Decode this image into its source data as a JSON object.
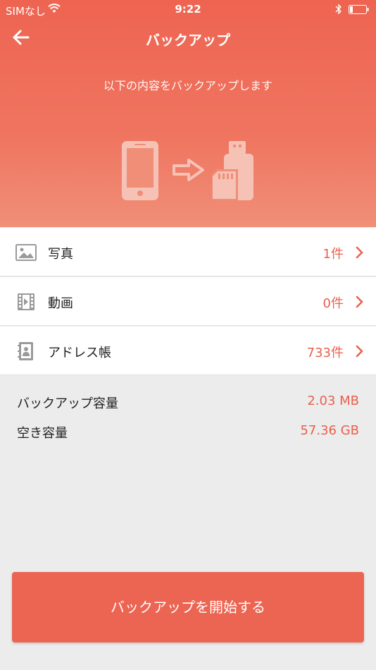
{
  "status_bar": {
    "carrier": "SIMなし",
    "time": "9:22",
    "icons": [
      "wifi-icon",
      "bluetooth-icon",
      "battery-icon"
    ]
  },
  "header": {
    "title": "バックアップ",
    "subtitle": "以下の内容をバックアップします",
    "back_icon": "arrow-left-icon",
    "illustration": [
      "phone-icon",
      "arrow-right-icon",
      "usb-drive-icon",
      "sd-card-icon"
    ],
    "gradient_colors": [
      "#ee6451",
      "#f08f78"
    ]
  },
  "items": [
    {
      "label": "写真",
      "count": "1件",
      "icon": "photo-icon"
    },
    {
      "label": "動画",
      "count": "0件",
      "icon": "video-icon"
    },
    {
      "label": "アドレス帳",
      "count": "733件",
      "icon": "contacts-icon"
    }
  ],
  "info": [
    {
      "label": "バックアップ容量",
      "value": "2.03 MB"
    },
    {
      "label": "空き容量",
      "value": "57.36 GB"
    }
  ],
  "start_button": {
    "label": "バックアップを開始する"
  },
  "colors": {
    "accent": "#ec6553",
    "value_text": "#e8604d",
    "background": "#ececec"
  }
}
